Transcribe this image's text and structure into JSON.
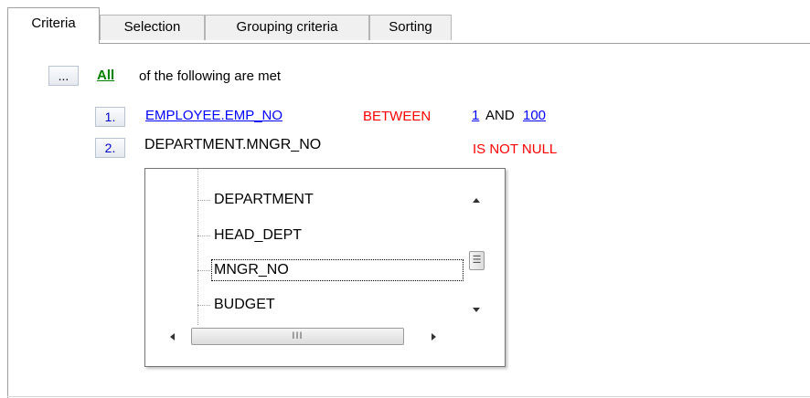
{
  "tabs": [
    {
      "label": "Criteria",
      "active": true
    },
    {
      "label": "Selection"
    },
    {
      "label": "Grouping criteria"
    },
    {
      "label": "Sorting"
    }
  ],
  "root": {
    "ellipsis_label": "...",
    "operator_label": "All",
    "condition_text": "of the following are met"
  },
  "conditions": [
    {
      "index": "1.",
      "field": "EMPLOYEE.EMP_NO",
      "operator": "BETWEEN",
      "value1": "1",
      "conjunction": "AND",
      "value2": "100"
    },
    {
      "index": "2.",
      "field": "DEPARTMENT.MNGR_NO",
      "operator": "IS NOT NULL"
    }
  ],
  "field_tree": {
    "items": [
      "DEPARTMENT",
      "HEAD_DEPT",
      "MNGR_NO",
      "BUDGET"
    ],
    "focused": "MNGR_NO",
    "hscroll_grip": "III",
    "vscroll_grip": "☰"
  },
  "colors": {
    "link_blue": "#0000ff",
    "link_green": "#008000",
    "operator_red": "#ff0000"
  }
}
